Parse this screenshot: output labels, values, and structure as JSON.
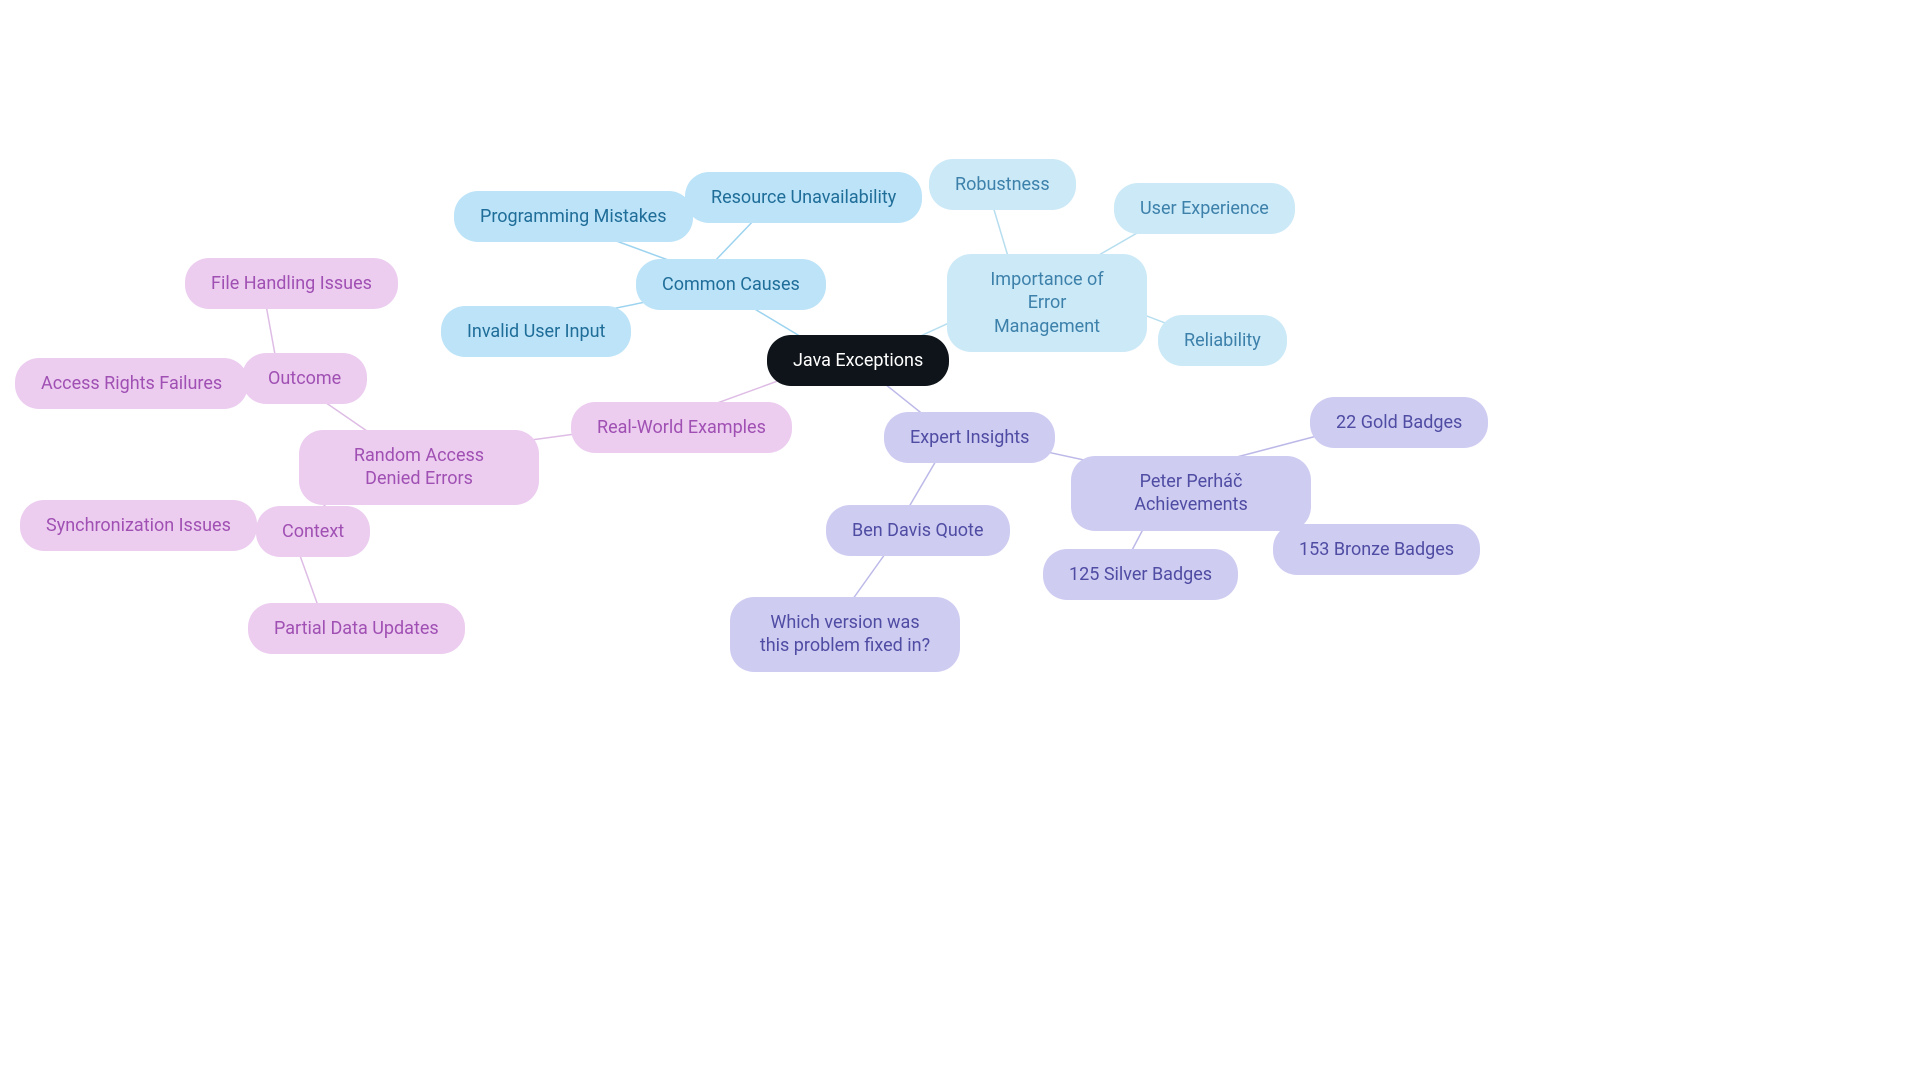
{
  "root": {
    "label": "Java Exceptions"
  },
  "commonCauses": {
    "label": "Common Causes",
    "children": {
      "programmingMistakes": "Programming Mistakes",
      "resourceUnavailability": "Resource Unavailability",
      "invalidUserInput": "Invalid User Input"
    }
  },
  "importance": {
    "label": "Importance of Error Management",
    "children": {
      "robustness": "Robustness",
      "userExperience": "User Experience",
      "reliability": "Reliability"
    }
  },
  "realWorld": {
    "label": "Real-World Examples",
    "randomAccess": {
      "label": "Random Access Denied Errors",
      "outcome": {
        "label": "Outcome",
        "children": {
          "fileHandling": "File Handling Issues",
          "accessRights": "Access Rights Failures"
        }
      },
      "context": {
        "label": "Context",
        "children": {
          "sync": "Synchronization Issues",
          "partial": "Partial Data Updates"
        }
      }
    }
  },
  "expertInsights": {
    "label": "Expert Insights",
    "benDavis": {
      "label": "Ben Davis Quote",
      "quote": "Which version was this problem fixed in?"
    },
    "peter": {
      "label": "Peter Perháč Achievements",
      "badges": {
        "gold": "22 Gold Badges",
        "silver": "125 Silver Badges",
        "bronze": "153 Bronze Badges"
      }
    }
  },
  "colors": {
    "root": "#0e1419",
    "blue": "#bce3f7",
    "lblue": "#cce9f7",
    "pink": "#eccdf0",
    "purple": "#cfccf2",
    "edgeBlue": "#9cd3ef",
    "edgeLBlue": "#b6deef",
    "edgePink": "#debce5",
    "edgePurple": "#bcb9e8"
  }
}
